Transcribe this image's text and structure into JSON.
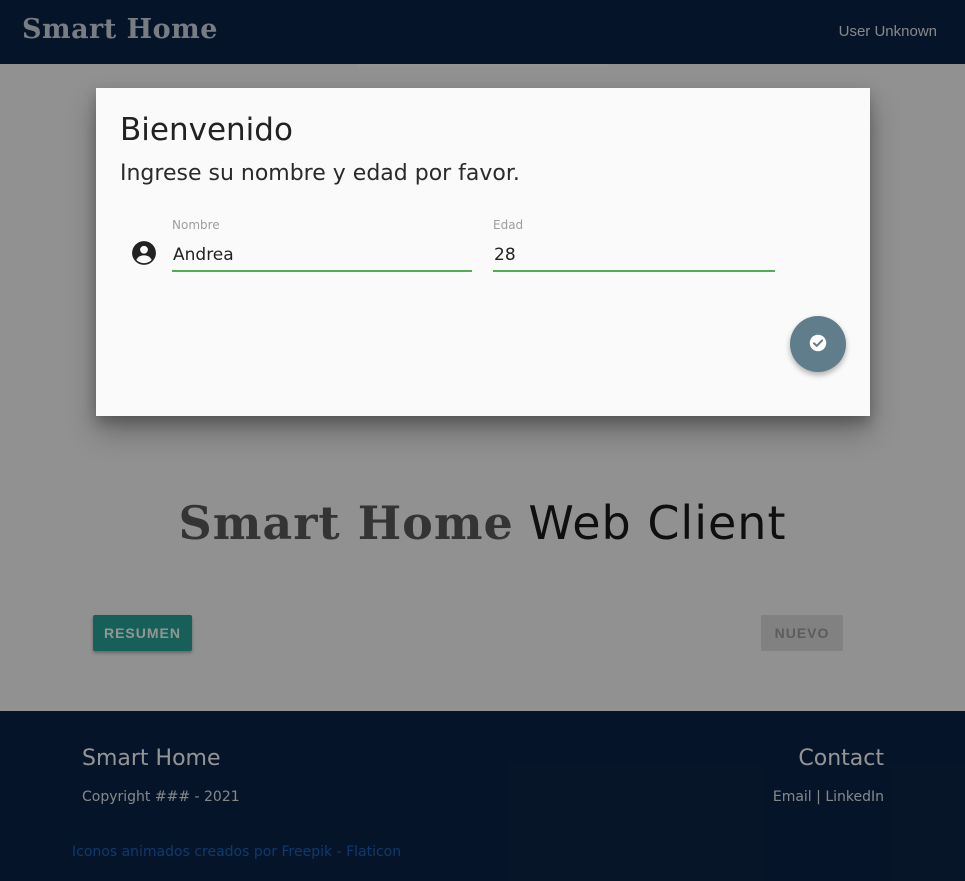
{
  "navbar": {
    "brand": "Smart Home",
    "user": "User Unknown"
  },
  "hero": {
    "brand": "Smart Home",
    "rest": "Web Client"
  },
  "buttons": {
    "resumen": "RESUMEN",
    "nuevo": "NUEVO"
  },
  "footer": {
    "title": "Smart Home",
    "copyright": "Copyright ### - 2021",
    "contact_title": "Contact",
    "email": "Email",
    "separator": "|",
    "linkedin": "LinkedIn",
    "credit": "Iconos animados creados por Freepik - Flaticon"
  },
  "modal": {
    "title": "Bienvenido",
    "subtitle": "Ingrese su nombre y edad por favor.",
    "name_label": "Nombre",
    "name_value": "Andrea",
    "age_label": "Edad",
    "age_value": "28",
    "icon": "account-circle-icon",
    "submit_icon": "check-circle-icon"
  },
  "colors": {
    "navbar": "#0c2447",
    "accent_teal": "#26a69a",
    "fab": "#607d8b",
    "input_underline": "#4caf50",
    "credit_link": "#1565c0"
  }
}
